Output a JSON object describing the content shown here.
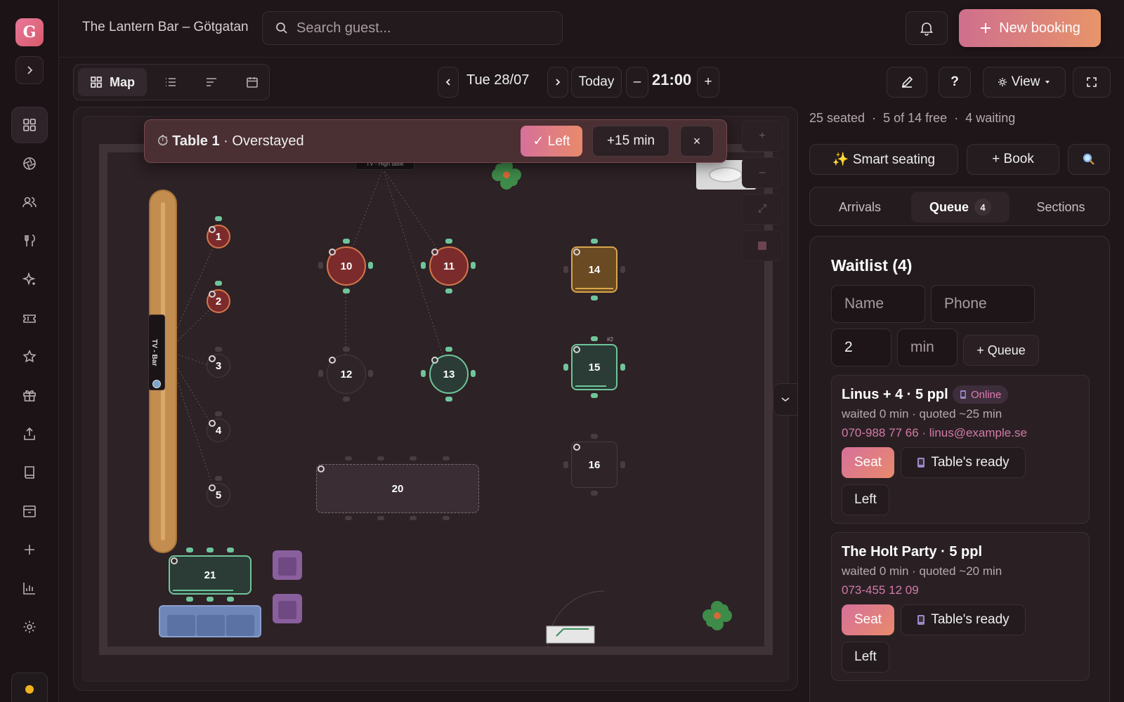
{
  "app": {
    "avatar_letter": "G",
    "venue_title": "The Lantern Bar – Götgatan"
  },
  "search": {
    "placeholder": "Search guest..."
  },
  "header": {
    "new_booking": "New booking"
  },
  "toolbar": {
    "map_label": "Map",
    "date": "Tue 28/07",
    "today": "Today",
    "minus": "–",
    "plus": "+",
    "time": "21:00",
    "help": "?",
    "view": "View"
  },
  "alert": {
    "table": "Table 1",
    "status": "Overstayed",
    "left_action": "✓ Left",
    "extend_action": "+15 min",
    "close": "×"
  },
  "map": {
    "tables": {
      "t1": "1",
      "t2": "2",
      "t3": "3",
      "t4": "4",
      "t5": "5",
      "t10": "10",
      "t11": "11",
      "t12": "12",
      "t13": "13",
      "t14": "14",
      "t15": "15",
      "t16": "16",
      "t20": "20",
      "t21": "21"
    },
    "tv_bar_label": "TV - Bar",
    "tv_high_label": "TV - High table",
    "t15_tag": "#2"
  },
  "panel": {
    "stats": {
      "seated": "25 seated",
      "free": "5 of 14 free",
      "waiting": "4 waiting",
      "separator": "·"
    },
    "smart_seating": "✨ Smart seating",
    "book": "+ Book",
    "tabs": {
      "arrivals": "Arrivals",
      "queue": "Queue",
      "queue_count": "4",
      "sections": "Sections"
    },
    "waitlist": {
      "title": "Waitlist (4)",
      "name_placeholder": "Name",
      "phone_placeholder": "Phone",
      "party_size": "2",
      "minutes_placeholder": "min",
      "queue_button": "+ Queue"
    },
    "entries": [
      {
        "name": "Linus + 4 · 5 ppl",
        "badge": "Online",
        "wait": "waited 0 min · quoted ~25 min",
        "contact": "070-988 77 66 · linus@example.se",
        "seat": "Seat",
        "ready": "Table's ready",
        "left": "Left"
      },
      {
        "name": "The Holt Party · 5 ppl",
        "wait": "waited 0 min · quoted ~20 min",
        "contact": "073-455 12 09",
        "seat": "Seat",
        "ready": "Table's ready",
        "left": "Left"
      }
    ]
  },
  "colors": {
    "accent": "#d6709a",
    "accent2": "#e98a6c",
    "background": "#1f1619",
    "occupied": "#8a2f30",
    "free": "#2f4a40",
    "overdue": "#7a5a2a"
  }
}
